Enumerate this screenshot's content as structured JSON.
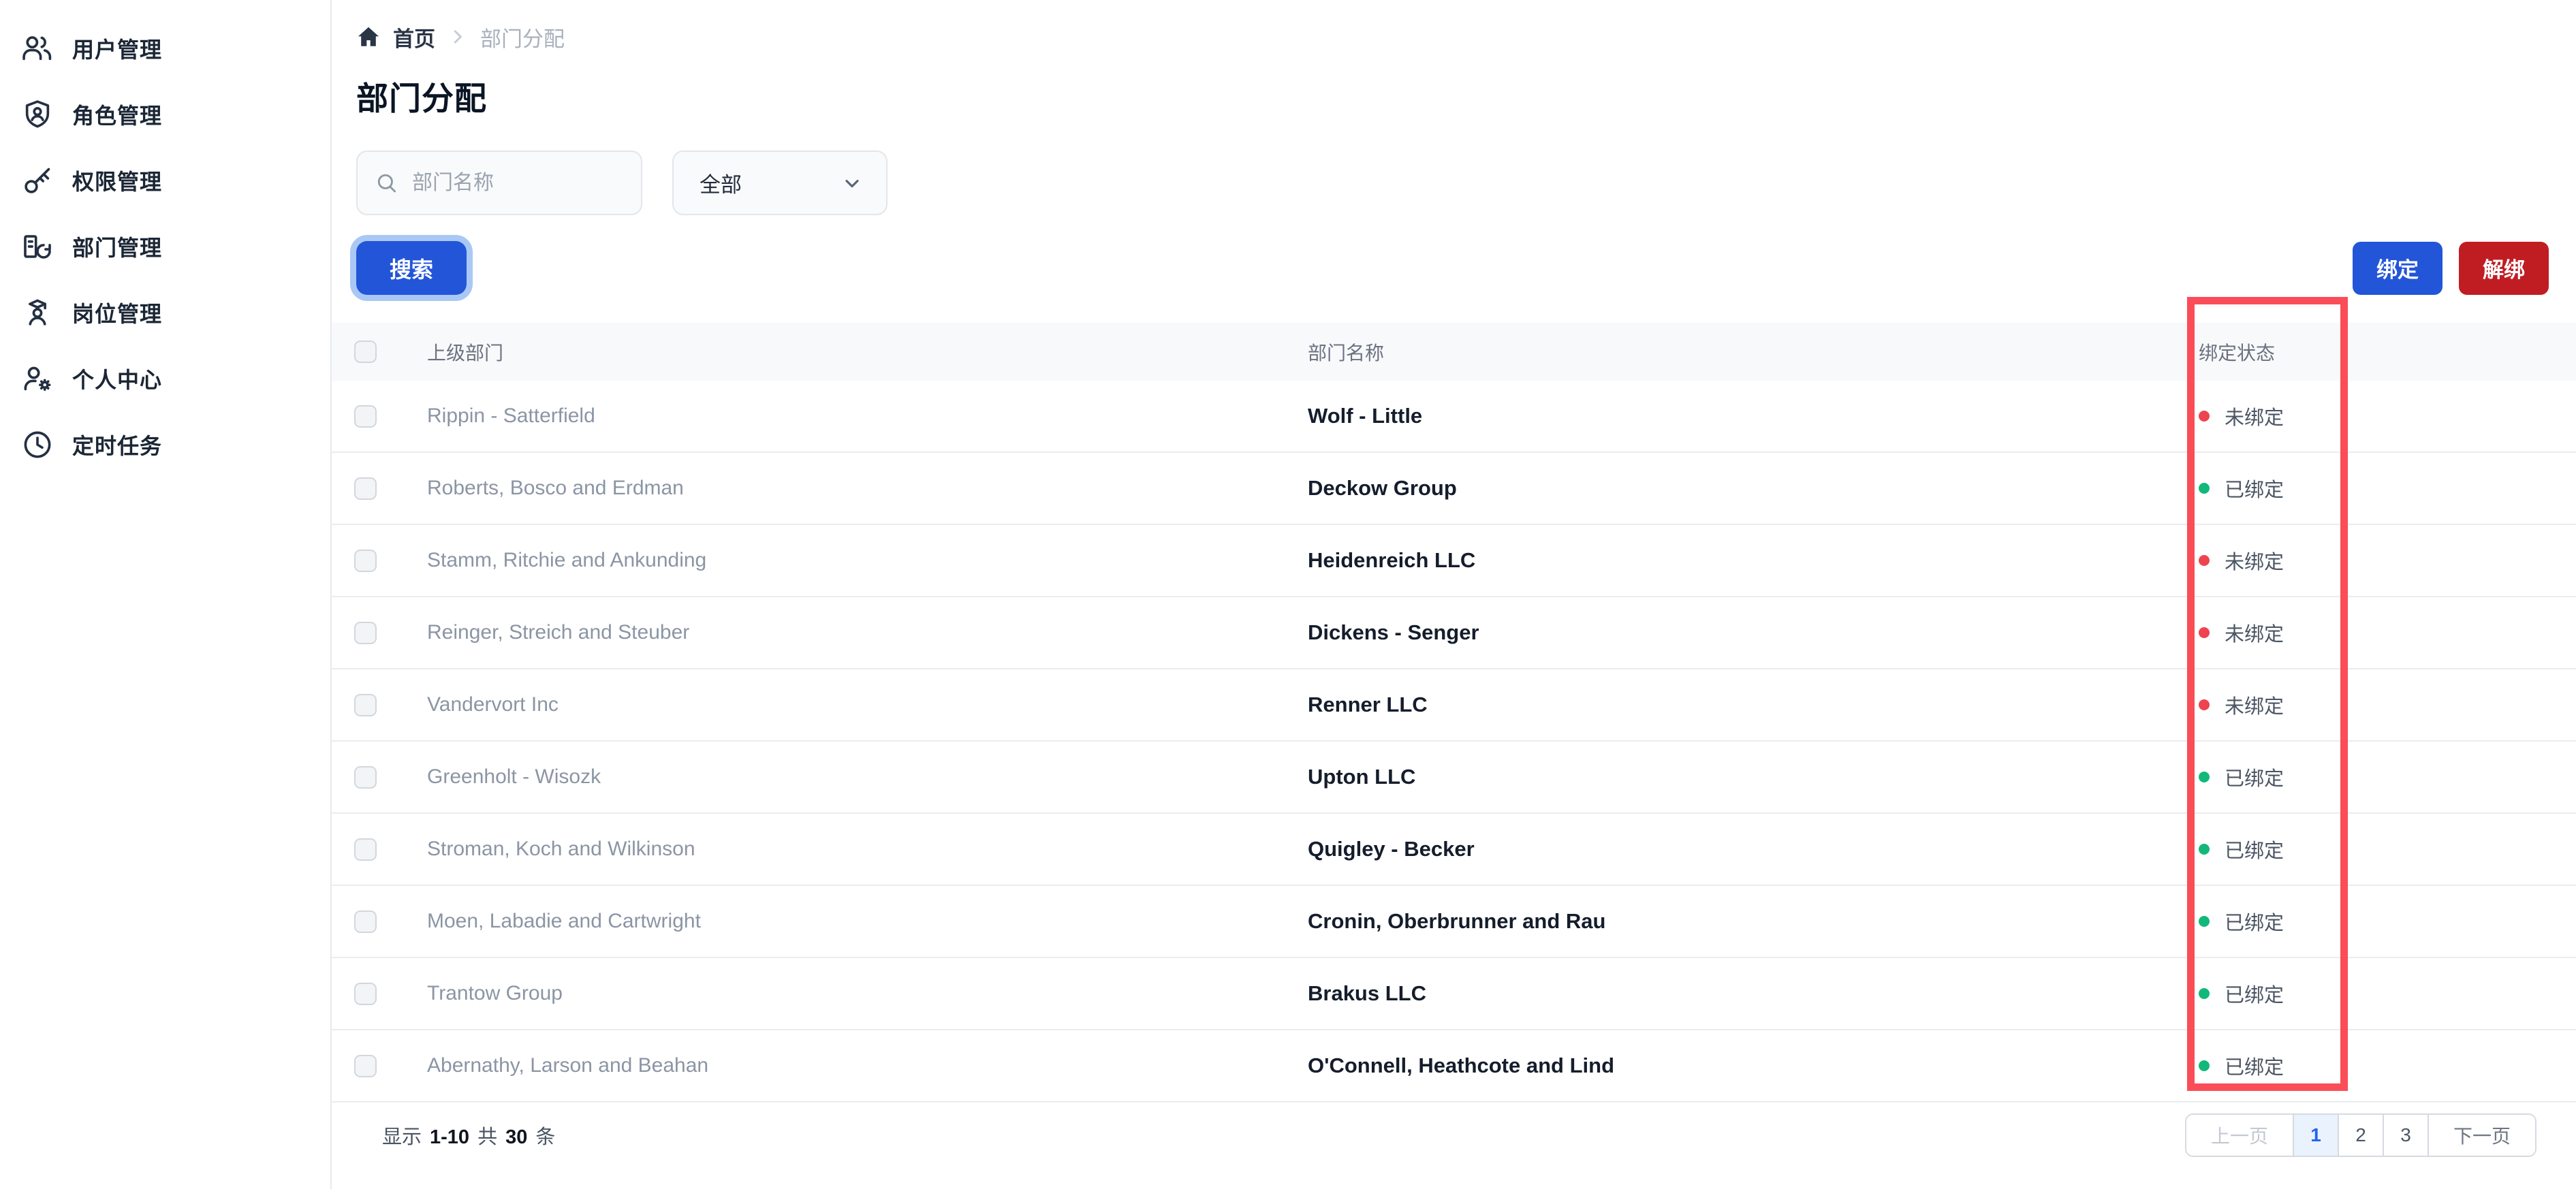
{
  "sidebar": {
    "items": [
      {
        "label": "用户管理",
        "icon": "users-icon"
      },
      {
        "label": "角色管理",
        "icon": "shield-user-icon"
      },
      {
        "label": "权限管理",
        "icon": "key-icon"
      },
      {
        "label": "部门管理",
        "icon": "department-icon"
      },
      {
        "label": "岗位管理",
        "icon": "position-icon"
      },
      {
        "label": "个人中心",
        "icon": "user-settings-icon"
      },
      {
        "label": "定时任务",
        "icon": "clock-icon"
      }
    ]
  },
  "breadcrumb": {
    "home": "首页",
    "current": "部门分配"
  },
  "page": {
    "title": "部门分配"
  },
  "filters": {
    "search_placeholder": "部门名称",
    "type_selected": "全部",
    "search_button": "搜索"
  },
  "actions": {
    "bind": "绑定",
    "unbind": "解绑"
  },
  "table": {
    "headers": {
      "parent": "上级部门",
      "name": "部门名称",
      "status": "绑定状态"
    },
    "status_labels": {
      "bound": "已绑定",
      "unbound": "未绑定"
    },
    "rows": [
      {
        "parent": "Rippin - Satterfield",
        "name": "Wolf - Little",
        "status": "未绑定",
        "bound": false
      },
      {
        "parent": "Roberts, Bosco and Erdman",
        "name": "Deckow Group",
        "status": "已绑定",
        "bound": true
      },
      {
        "parent": "Stamm, Ritchie and Ankunding",
        "name": "Heidenreich LLC",
        "status": "未绑定",
        "bound": false
      },
      {
        "parent": "Reinger, Streich and Steuber",
        "name": "Dickens - Senger",
        "status": "未绑定",
        "bound": false
      },
      {
        "parent": "Vandervort Inc",
        "name": "Renner LLC",
        "status": "未绑定",
        "bound": false
      },
      {
        "parent": "Greenholt - Wisozk",
        "name": "Upton LLC",
        "status": "已绑定",
        "bound": true
      },
      {
        "parent": "Stroman, Koch and Wilkinson",
        "name": "Quigley - Becker",
        "status": "已绑定",
        "bound": true
      },
      {
        "parent": "Moen, Labadie and Cartwright",
        "name": "Cronin, Oberbrunner and Rau",
        "status": "已绑定",
        "bound": true
      },
      {
        "parent": "Trantow Group",
        "name": "Brakus LLC",
        "status": "已绑定",
        "bound": true
      },
      {
        "parent": "Abernathy, Larson and Beahan",
        "name": "O'Connell, Heathcote and Lind",
        "status": "已绑定",
        "bound": true
      }
    ]
  },
  "pagination": {
    "summary": {
      "prefix": "显示",
      "range": "1-10",
      "middle": "共",
      "total": "30",
      "suffix": "条"
    },
    "prev": "上一页",
    "pages": [
      "1",
      "2",
      "3"
    ],
    "active_page": "1",
    "next": "下一页"
  },
  "colors": {
    "accent_blue": "#2355d8",
    "danger_red": "#c01d23",
    "status_bound": "#12b879",
    "status_unbound": "#ee4450",
    "annotation_red": "#fb4d58",
    "header_bg": "#f8f9fb"
  }
}
